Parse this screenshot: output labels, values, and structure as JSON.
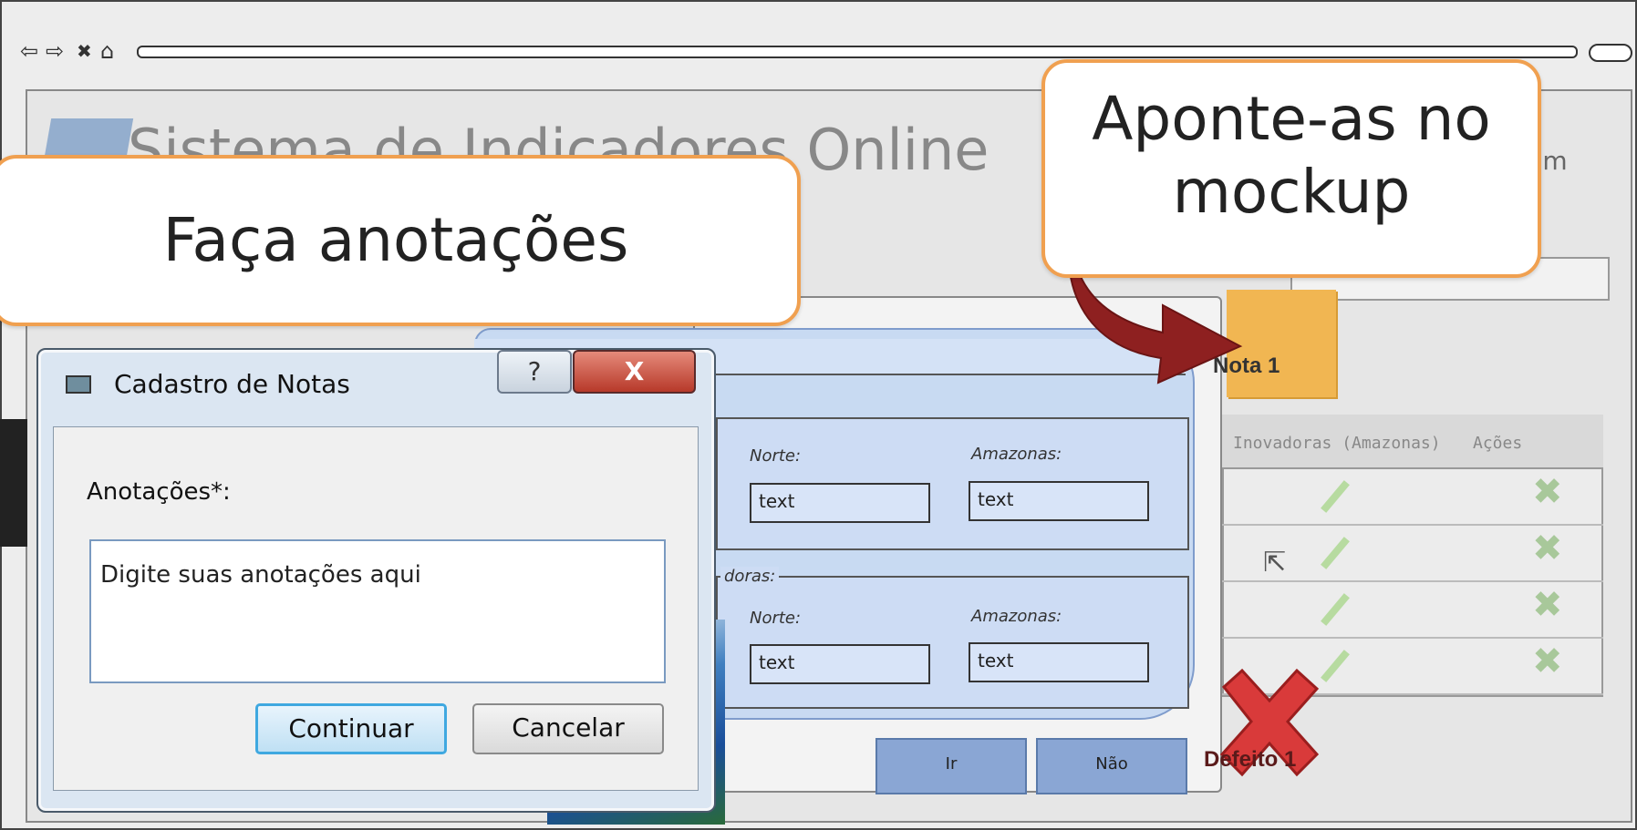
{
  "browser": {
    "nav_glyphs": [
      "⇦",
      "⇨",
      "✖",
      "⌂"
    ]
  },
  "app": {
    "title": "Sistema de Indicadores Online",
    "email_suffix": ".com"
  },
  "grid": {
    "columns": [
      "Inovadoras (Amazonas)",
      "Ações"
    ]
  },
  "mock_modal": {
    "fieldset1": {
      "label_norte": "Norte:",
      "label_amazonas": "Amazonas:",
      "value_norte": "text",
      "value_amazonas": "text"
    },
    "fieldset2": {
      "legend_fragment": "doras:",
      "label_norte": "Norte:",
      "label_amazonas": "Amazonas:",
      "value_norte": "text",
      "value_amazonas": "text"
    },
    "buttons": {
      "ir": "Ir",
      "nao": "Não"
    }
  },
  "note": {
    "label": "Nota 1",
    "color": "#f1b652"
  },
  "defect": {
    "label": "Defeito 1",
    "color": "#d93a3a"
  },
  "callouts": {
    "annotate": "Faça anotações",
    "point_line1": "Aponte-as no",
    "point_line2": "mockup",
    "border_color": "#f0a050"
  },
  "dialog": {
    "title": "Cadastro de Notas",
    "help_label": "?",
    "close_label": "X",
    "field_label": "Anotações*:",
    "field_value": "Digite suas anotações aqui",
    "continue_label": "Continuar",
    "cancel_label": "Cancelar"
  }
}
